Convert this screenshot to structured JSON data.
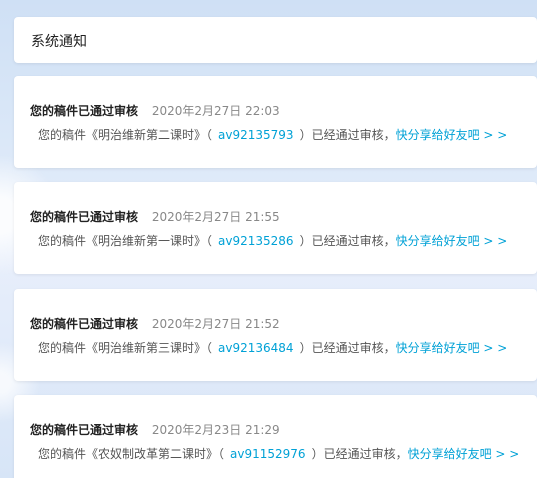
{
  "header": {
    "title": "系统通知"
  },
  "messages": [
    {
      "title": "您的稿件已通过审核",
      "time": "2020年2月27日 22:03",
      "text_before": "您的稿件《明治维新第二课时》（",
      "av": "av92135793",
      "text_after": "）已经通过审核，",
      "share": "快分享给好友吧 > >"
    },
    {
      "title": "您的稿件已通过审核",
      "time": "2020年2月27日 21:55",
      "text_before": "您的稿件《明治维新第一课时》（",
      "av": "av92135286",
      "text_after": "）已经通过审核，",
      "share": "快分享给好友吧 > >"
    },
    {
      "title": "您的稿件已通过审核",
      "time": "2020年2月27日 21:52",
      "text_before": "您的稿件《明治维新第三课时》（",
      "av": "av92136484",
      "text_after": "）已经通过审核，",
      "share": "快分享给好友吧 > >"
    },
    {
      "title": "您的稿件已通过审核",
      "time": "2020年2月23日 21:29",
      "text_before": "您的稿件《农奴制改革第二课时》（",
      "av": "av91152976",
      "text_after": "）已经通过审核，",
      "share": "快分享给好友吧 > >"
    }
  ],
  "colors": {
    "link": "#00a1d6",
    "background": "#dbe8f8"
  }
}
